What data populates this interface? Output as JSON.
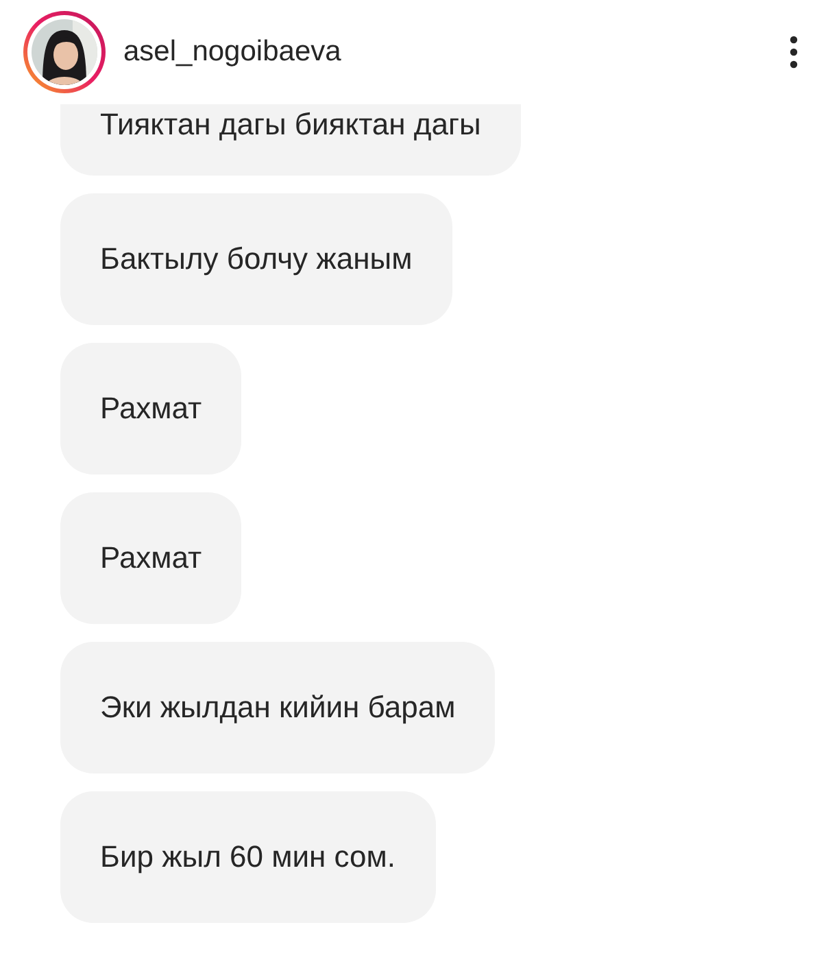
{
  "header": {
    "username": "asel_nogoibaeva",
    "avatar": {
      "story_ring": true
    }
  },
  "messages": [
    {
      "text": "Тияктан дагы бияктан дагы"
    },
    {
      "text": "Бактылу болчу жаным"
    },
    {
      "text": "Рахмат"
    },
    {
      "text": "Рахмат"
    },
    {
      "text": "Эки жылдан кийин барам"
    },
    {
      "text": "Бир жыл 60 мин сом."
    }
  ]
}
